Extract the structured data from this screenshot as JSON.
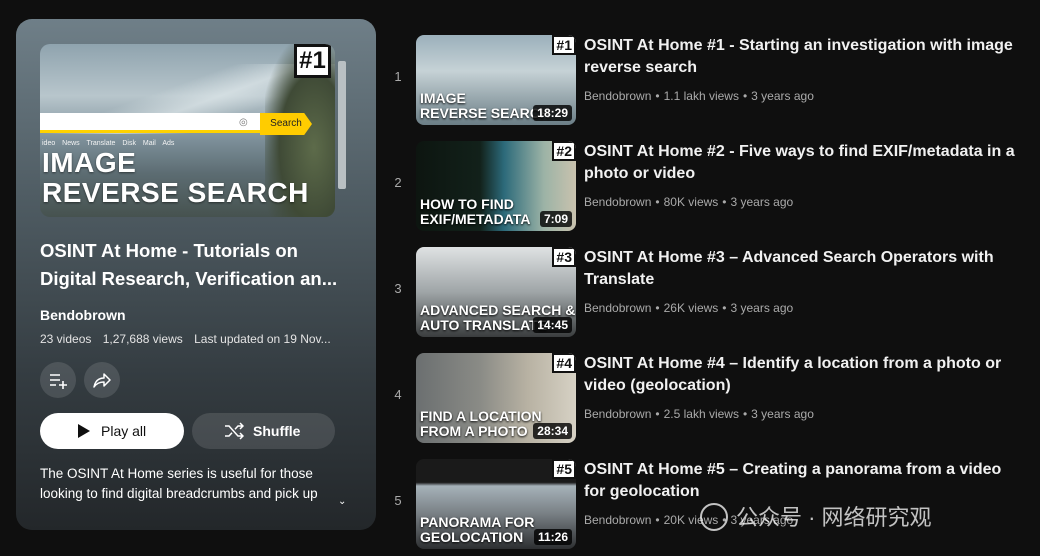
{
  "playlist": {
    "hero": {
      "badge": "#1",
      "search_label": "Search",
      "links": "ideo News Translate Disk Mail Ads",
      "big_line1": "IMAGE",
      "big_line2": "REVERSE SEARCH"
    },
    "title": "OSINT At Home - Tutorials on Digital Research, Verification an...",
    "owner": "Bendobrown",
    "video_count": "23 videos",
    "views": "1,27,688 views",
    "updated": "Last updated on 19 Nov...",
    "play_all": "Play all",
    "shuffle": "Shuffle",
    "description": "The OSINT At Home series is useful for those looking to find digital breadcrumbs and pick up",
    "more_glyph": "⌄"
  },
  "videos": [
    {
      "index": "1",
      "badge": "#1",
      "thumb_line1": "IMAGE",
      "thumb_line2": "REVERSE SEARCH",
      "duration": "18:29",
      "title": "OSINT At Home #1 - Starting an investigation with image reverse search",
      "channel": "Bendobrown",
      "views": "1.1 lakh views",
      "age": "3 years ago"
    },
    {
      "index": "2",
      "badge": "#2",
      "thumb_line1": "HOW TO FIND",
      "thumb_line2": "EXIF/METADATA",
      "duration": "7:09",
      "title": "OSINT At Home #2 - Five ways to find EXIF/metadata in a photo or video",
      "channel": "Bendobrown",
      "views": "80K views",
      "age": "3 years ago"
    },
    {
      "index": "3",
      "badge": "#3",
      "thumb_line1": "ADVANCED SEARCH &",
      "thumb_line2": "AUTO TRANSLATE",
      "duration": "14:45",
      "title": "OSINT At Home #3 – Advanced Search Operators with Translate",
      "channel": "Bendobrown",
      "views": "26K views",
      "age": "3 years ago"
    },
    {
      "index": "4",
      "badge": "#4",
      "thumb_line1": "FIND A LOCATION",
      "thumb_line2": "FROM A PHOTO",
      "duration": "28:34",
      "title": "OSINT At Home #4 – Identify a location from a photo or video (geolocation)",
      "channel": "Bendobrown",
      "views": "2.5 lakh views",
      "age": "3 years ago"
    },
    {
      "index": "5",
      "badge": "#5",
      "thumb_line1": "PANORAMA FOR",
      "thumb_line2": "GEOLOCATION",
      "duration": "11:26",
      "title": "OSINT At Home #5 – Creating a panorama from a video for geolocation",
      "channel": "Bendobrown",
      "views": "20K views",
      "age": "3 years ago"
    }
  ],
  "separator": "•",
  "watermark": "公众号 · 网络研究观"
}
